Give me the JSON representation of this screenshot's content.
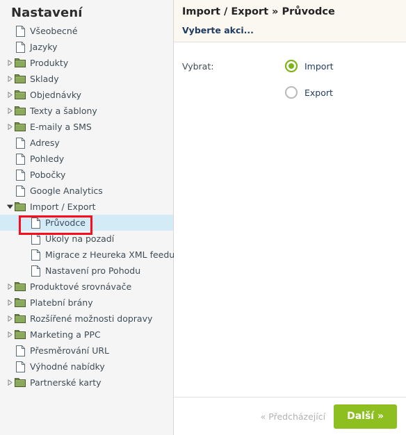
{
  "sidebar": {
    "title": "Nastavení",
    "items": [
      {
        "label": "Všeobecné",
        "icon": "file-icon",
        "indent": 0,
        "twisty": "none",
        "selected": false
      },
      {
        "label": "Jazyky",
        "icon": "file-icon",
        "indent": 0,
        "twisty": "none",
        "selected": false
      },
      {
        "label": "Produkty",
        "icon": "folder-icon",
        "indent": 0,
        "twisty": "collapsed",
        "selected": false
      },
      {
        "label": "Sklady",
        "icon": "folder-icon",
        "indent": 0,
        "twisty": "collapsed",
        "selected": false
      },
      {
        "label": "Objednávky",
        "icon": "folder-icon",
        "indent": 0,
        "twisty": "collapsed",
        "selected": false
      },
      {
        "label": "Texty a šablony",
        "icon": "folder-icon",
        "indent": 0,
        "twisty": "collapsed",
        "selected": false
      },
      {
        "label": "E-maily a SMS",
        "icon": "folder-icon",
        "indent": 0,
        "twisty": "collapsed",
        "selected": false
      },
      {
        "label": "Adresy",
        "icon": "file-icon",
        "indent": 0,
        "twisty": "none",
        "selected": false
      },
      {
        "label": "Pohledy",
        "icon": "file-icon",
        "indent": 0,
        "twisty": "none",
        "selected": false
      },
      {
        "label": "Pobočky",
        "icon": "file-icon",
        "indent": 0,
        "twisty": "none",
        "selected": false
      },
      {
        "label": "Google Analytics",
        "icon": "file-icon",
        "indent": 0,
        "twisty": "none",
        "selected": false
      },
      {
        "label": "Import / Export",
        "icon": "folder-icon",
        "indent": 0,
        "twisty": "expanded",
        "selected": false
      },
      {
        "label": "Průvodce",
        "icon": "file-icon",
        "indent": 1,
        "twisty": "none",
        "selected": true
      },
      {
        "label": "Úkoly na pozadí",
        "icon": "file-icon",
        "indent": 1,
        "twisty": "none",
        "selected": false
      },
      {
        "label": "Migrace z Heureka XML feedu",
        "icon": "file-icon",
        "indent": 1,
        "twisty": "none",
        "selected": false
      },
      {
        "label": "Nastavení pro Pohodu",
        "icon": "file-icon",
        "indent": 1,
        "twisty": "none",
        "selected": false
      },
      {
        "label": "Produktové srovnávače",
        "icon": "folder-icon",
        "indent": 0,
        "twisty": "collapsed",
        "selected": false
      },
      {
        "label": "Platební brány",
        "icon": "folder-icon",
        "indent": 0,
        "twisty": "collapsed",
        "selected": false
      },
      {
        "label": "Rozšířené možnosti dopravy",
        "icon": "folder-icon",
        "indent": 0,
        "twisty": "collapsed",
        "selected": false
      },
      {
        "label": "Marketing a PPC",
        "icon": "folder-icon",
        "indent": 0,
        "twisty": "collapsed",
        "selected": false
      },
      {
        "label": "Přesměrování URL",
        "icon": "file-icon",
        "indent": 0,
        "twisty": "none",
        "selected": false
      },
      {
        "label": "Výhodné nabídky",
        "icon": "file-icon",
        "indent": 0,
        "twisty": "none",
        "selected": false
      },
      {
        "label": "Partnerské karty",
        "icon": "folder-icon",
        "indent": 0,
        "twisty": "collapsed",
        "selected": false
      }
    ]
  },
  "panel": {
    "title": "Import / Export » Průvodce",
    "subtitle": "Vyberte akci...",
    "form": {
      "field_label": "Vybrat:",
      "options": [
        {
          "label": "Import",
          "selected": true
        },
        {
          "label": "Export",
          "selected": false
        }
      ]
    },
    "footer": {
      "prev_label": "« Předcházející",
      "next_label": "Další »"
    }
  },
  "annotations": [
    {
      "name": "annot-pruvodce",
      "target": "Průvodce"
    },
    {
      "name": "annot-import",
      "target": "Import"
    },
    {
      "name": "annot-next",
      "target": "Další »"
    }
  ],
  "colors": {
    "accent_green": "#8dbf21",
    "radio_green": "#7cb518",
    "folder_green": "#7fa24f",
    "selection_blue": "#d3eaf7",
    "annotation_red": "#fc0d1b",
    "header_cream": "#faf8f1",
    "sidebar_bg": "#f5f5f5",
    "text_dark": "#3f4c55"
  }
}
